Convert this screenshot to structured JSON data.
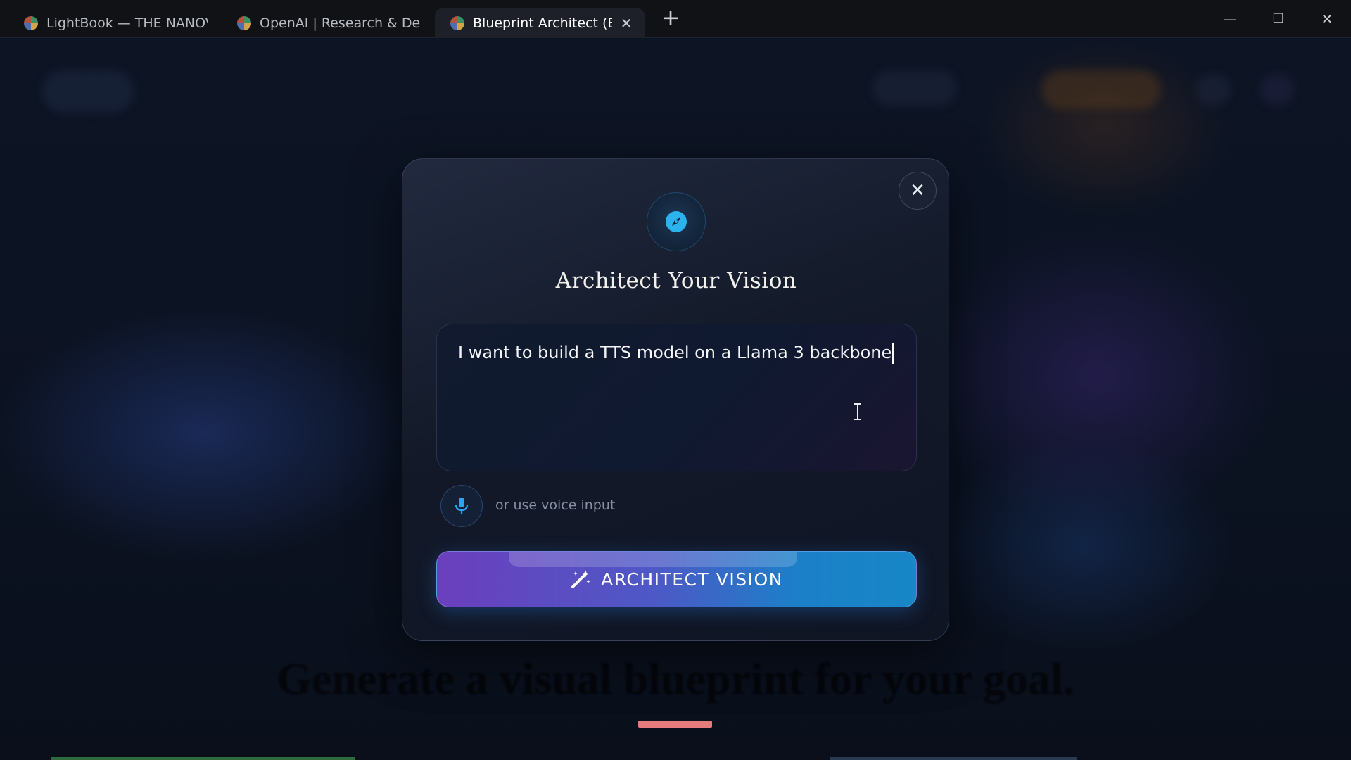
{
  "browser": {
    "tabs": [
      {
        "title": "LightBook — THE NANOVE...",
        "active": false
      },
      {
        "title": "OpenAI | Research & Deplo...",
        "active": false
      },
      {
        "title": "Blueprint Architect (Bet...",
        "active": true
      }
    ],
    "close_tab_glyph": "✕",
    "new_tab_glyph": "+",
    "window_controls": {
      "minimize": "—",
      "restore": "❐",
      "close": "✕"
    }
  },
  "modal": {
    "title": "Architect Your Vision",
    "icon": "compass-icon",
    "close_glyph": "✕",
    "vision_input_value": "I want to build a TTS model on a Llama 3 backbone",
    "voice_label": "or use voice input",
    "submit_label": "ARCHITECT VISION",
    "submit_icon": "magic-wand-icon"
  },
  "background_page": {
    "headline": "Generate a visual blueprint for your goal."
  },
  "colors": {
    "accent_start": "#6b3fbd",
    "accent_end": "#1787c6",
    "compass": "#2bb3ee",
    "underline": "#e47c7e"
  }
}
